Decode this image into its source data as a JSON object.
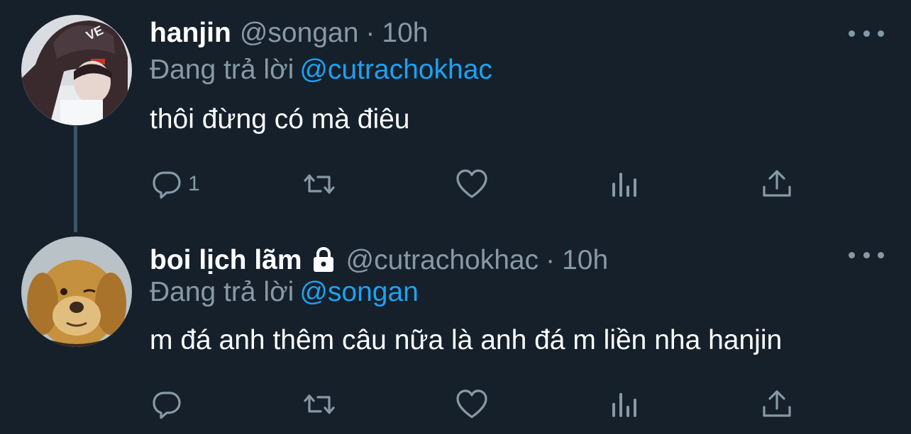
{
  "colors": {
    "background": "#15202b",
    "primary_text": "#ffffff",
    "secondary_text": "#8899a6",
    "accent": "#1da1f2",
    "thread_line": "#3d5466"
  },
  "tweets": [
    {
      "display_name": "hanjin",
      "handle": "@songan",
      "separator": "·",
      "time": "10h",
      "locked": false,
      "replying_label": "Đang trả lời",
      "replying_to": "@cutrachokhac",
      "text": "thôi đừng có mà điêu",
      "reply_count": "1",
      "avatar": "person-in-beanie-photo"
    },
    {
      "display_name": "boi lịch lãm",
      "handle": "@cutrachokhac",
      "separator": "·",
      "time": "10h",
      "locked": true,
      "replying_label": "Đang trả lời",
      "replying_to": "@songan",
      "text": "m đá anh thêm câu nữa là anh đá m liền nha hanjin",
      "reply_count": "",
      "avatar": "golden-retriever-photo"
    }
  ],
  "icons": {
    "reply": "reply-icon",
    "retweet": "retweet-icon",
    "like": "heart-icon",
    "stats": "stats-icon",
    "share": "share-icon",
    "more": "more-icon",
    "lock": "lock-icon"
  }
}
